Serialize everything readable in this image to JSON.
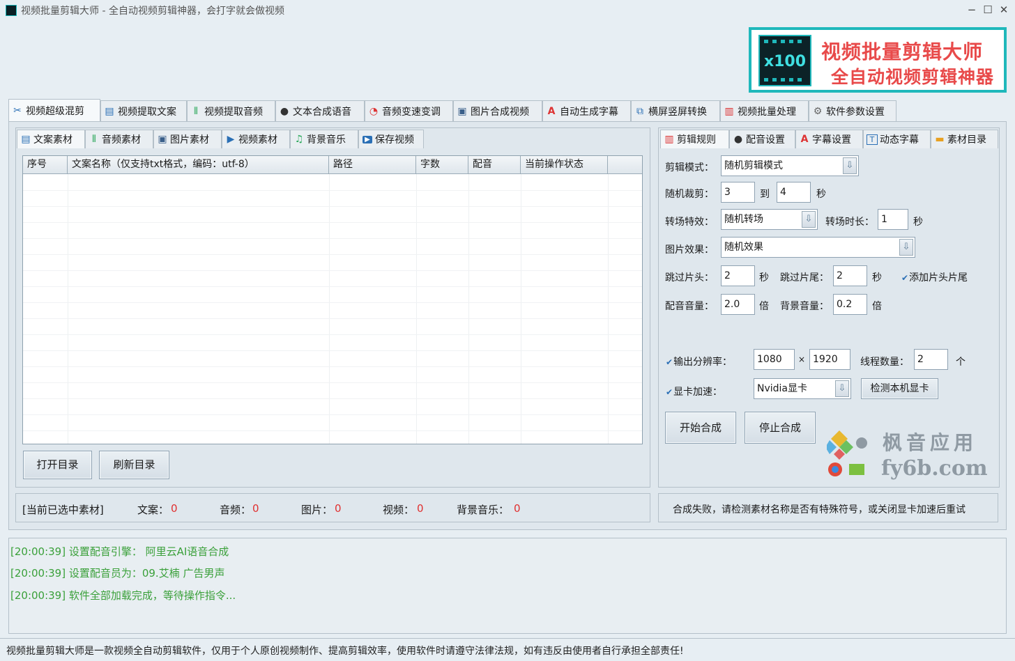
{
  "window": {
    "title": "视频批量剪辑大师 - 全自动视频剪辑神器，会打字就会做视频",
    "minimize": "−",
    "maximize": "☐",
    "close": "✕"
  },
  "logo": {
    "badge": "x100",
    "line1": "视频批量剪辑大师",
    "line2": "全自动视频剪辑神器"
  },
  "main_tabs": [
    {
      "label": "视频超级混剪",
      "icon": "scissors-icon",
      "glyph": "✂"
    },
    {
      "label": "视频提取文案",
      "icon": "document-icon",
      "glyph": "▤"
    },
    {
      "label": "视频提取音频",
      "icon": "audio-wave-icon",
      "glyph": "⦀"
    },
    {
      "label": "文本合成语音",
      "icon": "microphone-icon",
      "glyph": "●"
    },
    {
      "label": "音频变速变调",
      "icon": "speedometer-icon",
      "glyph": "◔"
    },
    {
      "label": "图片合成视频",
      "icon": "image-icon",
      "glyph": "▣"
    },
    {
      "label": "自动生成字幕",
      "icon": "font-icon",
      "glyph": "A"
    },
    {
      "label": "横屏竖屏转换",
      "icon": "rotate-screen-icon",
      "glyph": "⧉"
    },
    {
      "label": "视频批量处理",
      "icon": "film-icon",
      "glyph": "▥"
    },
    {
      "label": "软件参数设置",
      "icon": "gear-icon",
      "glyph": "⚙"
    }
  ],
  "left_tabs": [
    {
      "label": "文案素材",
      "glyph": "▤"
    },
    {
      "label": "音频素材",
      "glyph": "⦀"
    },
    {
      "label": "图片素材",
      "glyph": "▣"
    },
    {
      "label": "视频素材",
      "glyph": "▶"
    },
    {
      "label": "背景音乐",
      "glyph": "♫"
    },
    {
      "label": "保存视频",
      "glyph": "▶"
    }
  ],
  "table": {
    "columns": [
      "序号",
      "文案名称（仅支持txt格式，编码：utf-8）",
      "路径",
      "字数",
      "配音",
      "当前操作状态"
    ],
    "rows": []
  },
  "buttons": {
    "open_dir": "打开目录",
    "refresh_dir": "刷新目录",
    "detect_gpu": "检测本机显卡",
    "start": "开始合成",
    "stop": "停止合成"
  },
  "selection_status": {
    "title": "[当前已选中素材]",
    "text_label": "文案：",
    "text_count": "0",
    "audio_label": "音频：",
    "audio_count": "0",
    "image_label": "图片：",
    "image_count": "0",
    "video_label": "视频：",
    "video_count": "0",
    "bgm_label": "背景音乐：",
    "bgm_count": "0"
  },
  "right_tabs": [
    {
      "label": "剪辑规则",
      "glyph": "▥"
    },
    {
      "label": "配音设置",
      "glyph": "●"
    },
    {
      "label": "字幕设置",
      "glyph": "A"
    },
    {
      "label": "动态字幕",
      "glyph": "T"
    },
    {
      "label": "素材目录",
      "glyph": "▬"
    }
  ],
  "settings": {
    "edit_mode_label": "剪辑模式：",
    "edit_mode_value": "随机剪辑模式",
    "random_cut_label": "随机裁剪：",
    "random_cut_from": "3",
    "to_label": "到",
    "random_cut_to": "4",
    "sec_unit": "秒",
    "transition_label": "转场特效：",
    "transition_value": "随机转场",
    "transition_duration_label": "转场时长：",
    "transition_duration": "1",
    "image_effect_label": "图片效果：",
    "image_effect_value": "随机效果",
    "skip_head_label": "跳过片头：",
    "skip_head": "2",
    "skip_tail_label": "跳过片尾：",
    "skip_tail": "2",
    "add_head_tail": "添加片头片尾",
    "voice_volume_label": "配音音量：",
    "voice_volume": "2.0",
    "times_unit": "倍",
    "bg_volume_label": "背景音量：",
    "bg_volume": "0.2",
    "resolution_label": "输出分辨率：",
    "res_width": "1080",
    "res_x": "×",
    "res_height": "1920",
    "threads_label": "线程数量：",
    "threads": "2",
    "threads_unit": "个",
    "gpu_label": "显卡加速：",
    "gpu_value": "Nvidia显卡"
  },
  "right_status": "合成失败，请检测素材名称是否有特殊符号，或关闭显卡加速后重试",
  "watermark": {
    "line1": "枫音应用",
    "line2": "fy6b.com"
  },
  "log": [
    "[20:00:39] 设置配音引擎：  阿里云AI语音合成",
    "[20:00:39] 设置配音员为：09.艾楠 广告男声",
    "[20:00:39] 软件全部加载完成，等待操作指令..."
  ],
  "footer": "视频批量剪辑大师是一款视频全自动剪辑软件，仅用于个人原创视频制作、提高剪辑效率，使用软件时请遵守法律法规，如有违反由使用者自行承担全部责任!",
  "colors": {
    "accent_teal": "#1fb8bb",
    "logo_red": "#e84a4a",
    "count_red": "#e03030",
    "log_green": "#3aa03a"
  }
}
